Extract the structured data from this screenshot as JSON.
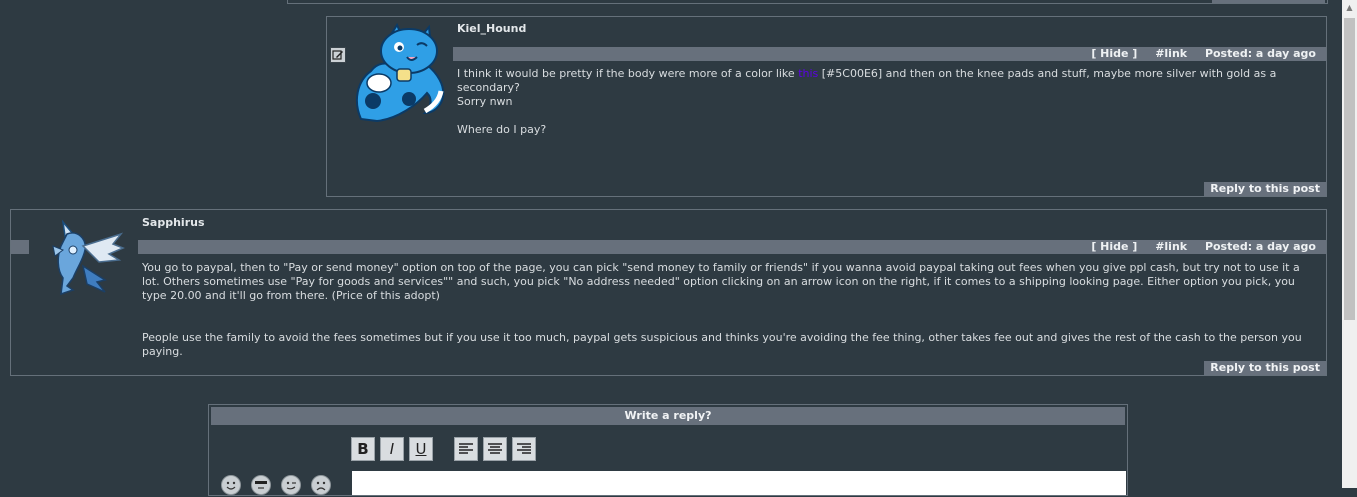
{
  "posts": [
    {
      "author": "Kiel_Hound",
      "hide_label": "[ Hide ]",
      "link_label": "#link",
      "posted": "Posted: a day ago",
      "body_lines": [
        "I think it would be pretty if the body were more of a color like",
        "this",
        "[#5C00E6] and then on the knee pads and stuff, maybe more silver with gold as a secondary?",
        "Sorry nwn",
        "Where do I pay?"
      ],
      "reply_label": "Reply to this post",
      "swatch_color": "#5C00E6"
    },
    {
      "author": "Sapphirus",
      "hide_label": "[ Hide ]",
      "link_label": "#link",
      "posted": "Posted: a day ago",
      "body_p1": "You go to paypal, then to \"Pay or send money\" option on top of the page, you can pick \"send money to family or friends\" if you wanna avoid paypal taking out fees when you give ppl cash, but try not to use it a lot. Others sometimes use \"Pay for goods and services\"\" and such, you pick \"No address needed\" option clicking on an arrow icon on the right, if it comes to a shipping looking page. Either option you pick, you type 20.00 and it'll go from there. (Price of this adopt)",
      "body_p2": "People use the family to avoid the fees sometimes but if you use it too much, paypal gets suspicious and thinks you're avoiding the fee thing, other takes fee out and gives the rest of the cash to the person you paying.",
      "reply_label": "Reply to this post"
    }
  ],
  "editor": {
    "title": "Write a reply?",
    "tools": [
      "B",
      "I",
      "U"
    ],
    "align_tools": [
      "align-left-icon",
      "align-center-icon",
      "align-right-icon"
    ],
    "emoticons": [
      "grin-icon",
      "cool-icon",
      "wink-icon",
      "sad-icon"
    ]
  },
  "colors": {
    "background": "#2e3a42",
    "bar": "#67707c",
    "border": "#65707a"
  }
}
